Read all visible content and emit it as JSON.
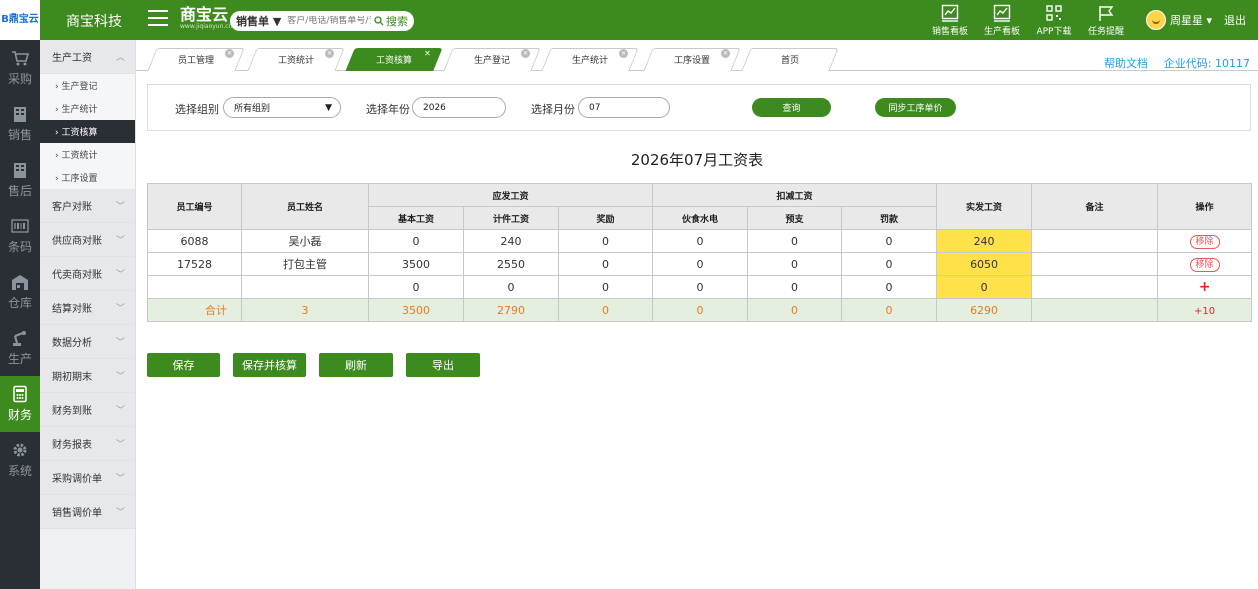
{
  "app": {
    "logo_text": "B鼎宝云",
    "company": "商宝科技",
    "brand_name": "商宝云",
    "brand_sub": "www.jiqiaoyun.cn"
  },
  "search": {
    "type_label": "销售单 ▼",
    "placeholder": "客户/电话/销售单号/订单号",
    "button_label": "搜索"
  },
  "top_icons": [
    {
      "label": "销售看板",
      "icon": "chart-icon"
    },
    {
      "label": "生产看板",
      "icon": "chart-icon"
    },
    {
      "label": "APP下载",
      "icon": "qrcode-icon"
    },
    {
      "label": "任务提醒",
      "icon": "flag-icon"
    }
  ],
  "user": {
    "name": "周星星 ▾",
    "logout": "退出"
  },
  "leftbar": [
    {
      "label": "采购",
      "icon": "cart-icon"
    },
    {
      "label": "销售",
      "icon": "building-icon"
    },
    {
      "label": "售后",
      "icon": "building-icon"
    },
    {
      "label": "条码",
      "icon": "barcode-icon"
    },
    {
      "label": "仓库",
      "icon": "warehouse-icon"
    },
    {
      "label": "生产",
      "icon": "robot-arm-icon"
    },
    {
      "label": "财务",
      "icon": "calculator-icon"
    },
    {
      "label": "系统",
      "icon": "gear-icon"
    }
  ],
  "submenu": {
    "groups": [
      "生产工资",
      "客户对账",
      "供应商对账",
      "代卖商对账",
      "结算对账",
      "数据分析",
      "期初期末",
      "财务到账",
      "财务报表",
      "采购调价单",
      "销售调价单"
    ],
    "subitems": [
      "› 生产登记",
      "› 生产统计",
      "› 工资核算",
      "› 工资统计",
      "› 工序设置"
    ]
  },
  "tabs": [
    "员工管理",
    "工资统计",
    "工资核算",
    "生产登记",
    "生产统计",
    "工序设置",
    "首页"
  ],
  "help_link": "帮助文档",
  "corp_code": "企业代码: 10117",
  "filter": {
    "group_label": "选择组别",
    "group_value": "所有组别",
    "year_label": "选择年份",
    "year_value": "2026",
    "month_label": "选择月份",
    "month_value": "07",
    "query_btn": "查询",
    "sync_btn": "同步工序单价"
  },
  "table_title": "2026年07月工资表",
  "table": {
    "h_emp_no": "员工编号",
    "h_emp_name": "员工姓名",
    "h_payable": "应发工资",
    "h_deduct": "扣减工资",
    "h_actual": "实发工资",
    "h_remark": "备注",
    "h_op": "操作",
    "h_base": "基本工资",
    "h_piece": "计件工资",
    "h_bonus": "奖励",
    "h_food": "伙食水电",
    "h_advance": "预支",
    "h_fine": "罚款",
    "rows": [
      {
        "no": "6088",
        "name": "吴小磊",
        "base": "0",
        "piece": "240",
        "bonus": "0",
        "food": "0",
        "advance": "0",
        "fine": "0",
        "actual": "240",
        "remark": "",
        "op": "移除"
      },
      {
        "no": "17528",
        "name": "打包主管",
        "base": "3500",
        "piece": "2550",
        "bonus": "0",
        "food": "0",
        "advance": "0",
        "fine": "0",
        "actual": "6050",
        "remark": "",
        "op": "移除"
      },
      {
        "no": "",
        "name": "",
        "base": "0",
        "piece": "0",
        "bonus": "0",
        "food": "0",
        "advance": "0",
        "fine": "0",
        "actual": "0",
        "remark": "",
        "op": "+"
      }
    ],
    "total": {
      "label": "合计",
      "count": "3",
      "base": "3500",
      "piece": "2790",
      "bonus": "0",
      "food": "0",
      "advance": "0",
      "fine": "0",
      "actual": "6290",
      "remark": "",
      "op": "+10"
    }
  },
  "actions": [
    "保存",
    "保存并核算",
    "刷新",
    "导出"
  ],
  "colors": {
    "brand_green": "#3d8b1e",
    "highlight": "#ffe14a",
    "total_bg": "#e4efdf",
    "total_text": "#e97b1e",
    "link": "#1e9ee8"
  }
}
